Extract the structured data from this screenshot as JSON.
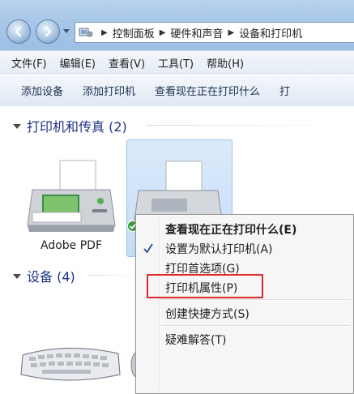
{
  "address_bar": {
    "crumbs": [
      "控制面板",
      "硬件和声音",
      "设备和打印机"
    ]
  },
  "menu": {
    "items": [
      "文件(F)",
      "编辑(E)",
      "查看(V)",
      "工具(T)",
      "帮助(H)"
    ]
  },
  "commands": {
    "items": [
      "添加设备",
      "添加打印机",
      "查看现在正在打印什么",
      "打"
    ]
  },
  "groups": {
    "printers": {
      "title": "打印机和传真 (2)"
    },
    "devices": {
      "title": "设备 (4)"
    }
  },
  "printers": [
    {
      "name": "Adobe PDF"
    }
  ],
  "devices": [
    {
      "name": ""
    }
  ],
  "context_menu": {
    "items": [
      {
        "label": "查看现在正在打印什么(E)",
        "bold": true
      },
      {
        "label": "设置为默认打印机(A)",
        "checked": true
      },
      {
        "label": "打印首选项(G)"
      },
      {
        "label": "打印机属性(P)",
        "highlighted": true
      },
      {
        "label": "创建快捷方式(S)"
      },
      {
        "label": "疑难解答(T)"
      }
    ]
  },
  "colors": {
    "highlight_box": "#e02a2a",
    "group_header": "#1e3287",
    "selection": "#c5dcf6"
  }
}
